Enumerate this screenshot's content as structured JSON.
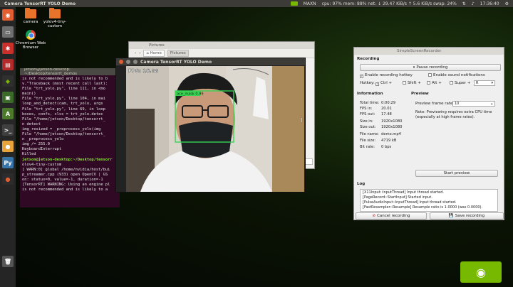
{
  "topbar": {
    "title": "Camera TensorRT YOLO Demo",
    "mode": "MAXN",
    "stats": "cpu: 97% mem: 88% net: ↓ 29.47 KiB/s ↑ 5.6 KiB/s swap: 24%",
    "time": "17:36:40"
  },
  "desktop_icons": [
    {
      "label": "camera"
    },
    {
      "label": "yolov4-tiny-custom"
    },
    {
      "label": "Chromium Web Browser"
    }
  ],
  "terminal": {
    "title": "jetson@jetson-desktop: ~/Desktop/tensorrt_demos",
    "lines": [
      "is not recommended and is likely to b",
      "v.\"Traceback (most recent call last):",
      "  File \"trt_yolo.py\", line 111, in <mo",
      "    main()",
      "  File \"trt_yolo.py\", line 104, in mai",
      "    loop_and_detect(cam, trt_yolo, args",
      "  File \"trt_yolo.py\", line 69, in loop",
      "    boxes, confs, clss = trt_yolo.detec",
      "  File \"/home/jetson/Desktop/tensorrt_",
      "n detect",
      "    img_resized = _preprocess_yolo(img",
      "  File \"/home/jetson/Desktop/tensorrt_",
      "n _preprocess_yolo",
      "    img /= 255.0",
      "KeyboardInterrupt",
      "Killed",
      "jetson@jetson-desktop:~/Desktop/tensorr",
      "olov4-tiny-custom",
      "[ WARN:0] global /home/nvidia/host/bui",
      "p_streamer.cpp (933) open OpenCV | GS",
      "on: status=0, value=-1, duration=-1",
      "[TensorRT] WARNING: Using an engine pl",
      "is not recommended and is likely to a"
    ]
  },
  "files": {
    "title": "Pictures",
    "breadcrumb_home": "Home",
    "breadcrumb_current": "Pictures",
    "status": "cted (2.0 MB)"
  },
  "camera": {
    "title": "Camera TensorRT YOLO Demo",
    "fps": "FPS: 16.88",
    "detection_label": "ace_mask 0.99"
  },
  "recorder": {
    "title": "SimpleScreenRecorder",
    "recording_header": "Recording",
    "pause_label": "Pause recording",
    "enable_hotkey": "Enable recording hotkey",
    "enable_sound": "Enable sound notifications",
    "hotkey_label": "Hotkey:",
    "ctrl": "Ctrl +",
    "shift": "Shift +",
    "alt": "Alt +",
    "super": "Super +",
    "key": "R",
    "information_header": "Information",
    "info": [
      {
        "key": "Total time:",
        "value": "0:00:29"
      },
      {
        "key": "FPS in:",
        "value": "20.01"
      },
      {
        "key": "FPS out:",
        "value": "17.48"
      },
      {
        "key": "Size in:",
        "value": "1920x1080"
      },
      {
        "key": "Size out:",
        "value": "1920x1080"
      },
      {
        "key": "File name:",
        "value": "demo.mp4"
      },
      {
        "key": "File size:",
        "value": "4719 kB"
      },
      {
        "key": "Bit rate:",
        "value": "0 bps"
      }
    ],
    "preview_header": "Preview",
    "preview_rate_label": "Preview frame rate:",
    "preview_rate_value": "10",
    "preview_note": "Note: Previewing requires extra CPU time (especially at high frame rates).",
    "start_preview": "Start preview",
    "log_header": "Log",
    "log": [
      "[X11Input::InputThread] Input thread started.",
      "[PageRecord::StartInput] Started input.",
      "[PulseAudioInput::InputThread] Input thread started.",
      "[FastResampler::Resample] Resample ratio is 1.0000 (was 0.0000)."
    ],
    "cancel_label": "Cancel recording",
    "save_label": "Save recording"
  },
  "colors": {
    "nvidia_green": "#76b900",
    "terminal_bg": "#300a24",
    "ubuntu_orange": "#e25d30",
    "detection_box": "#39d353"
  }
}
